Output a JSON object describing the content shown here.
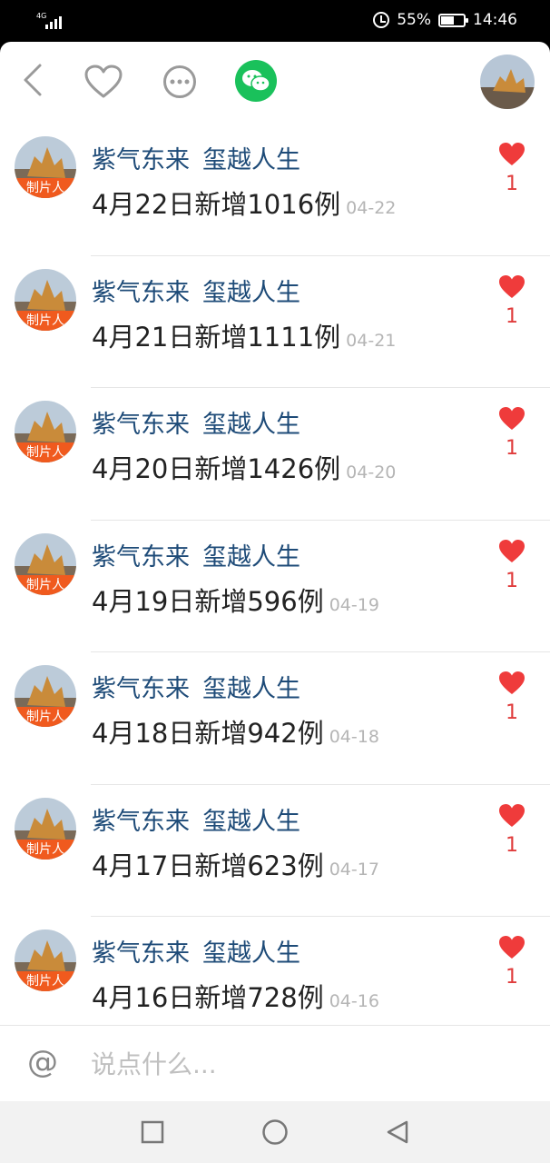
{
  "status": {
    "network": "4G",
    "battery": "55%",
    "battery_level": 0.55,
    "time": "14:46"
  },
  "top_bar": {
    "icons": [
      "back-icon",
      "heart-outline-icon",
      "more-icon",
      "wechat-icon",
      "avatar"
    ]
  },
  "colors": {
    "author": "#1e4b78",
    "badge": "#f05a1e",
    "heart": "#ef3b3b",
    "wechat": "#1ac15b"
  },
  "comments": [
    {
      "author_first": "紫气东来",
      "author_second": "玺越人生",
      "badge": "制片人",
      "content": "4月22日新增1016例",
      "date": "04-22",
      "likes": "1"
    },
    {
      "author_first": "紫气东来",
      "author_second": "玺越人生",
      "badge": "制片人",
      "content": "4月21日新增1111例",
      "date": "04-21",
      "likes": "1"
    },
    {
      "author_first": "紫气东来",
      "author_second": "玺越人生",
      "badge": "制片人",
      "content": "4月20日新增1426例",
      "date": "04-20",
      "likes": "1"
    },
    {
      "author_first": "紫气东来",
      "author_second": "玺越人生",
      "badge": "制片人",
      "content": "4月19日新增596例",
      "date": "04-19",
      "likes": "1"
    },
    {
      "author_first": "紫气东来",
      "author_second": "玺越人生",
      "badge": "制片人",
      "content": "4月18日新增942例",
      "date": "04-18",
      "likes": "1"
    },
    {
      "author_first": "紫气东来",
      "author_second": "玺越人生",
      "badge": "制片人",
      "content": "4月17日新增623例",
      "date": "04-17",
      "likes": "1"
    },
    {
      "author_first": "紫气东来",
      "author_second": "玺越人生",
      "badge": "制片人",
      "content": "4月16日新增728例",
      "date": "04-16",
      "likes": "1"
    }
  ],
  "comment_bar": {
    "placeholder": "说点什么..."
  },
  "nav": {
    "icons": [
      "recents-square-icon",
      "home-circle-icon",
      "back-triangle-icon"
    ]
  }
}
